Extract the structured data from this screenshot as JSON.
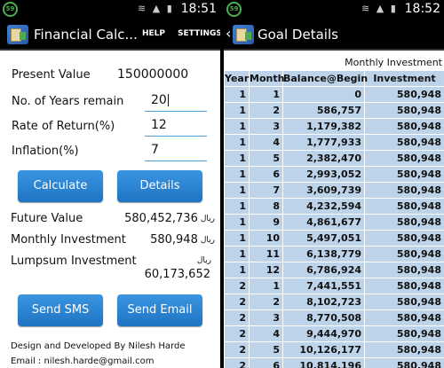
{
  "status": {
    "badge": "59",
    "time_left": "18:51",
    "time_right": "18:52"
  },
  "left_screen": {
    "title": "Financial Calc...",
    "menu": {
      "help": "HELP",
      "settings": "SETTINGS"
    },
    "fields": {
      "present_value": {
        "label": "Present Value",
        "value": "150000000"
      },
      "years": {
        "label": "No. of Years remain",
        "value": "20"
      },
      "return_rate": {
        "label": "Rate of Return(%)",
        "value": "12"
      },
      "inflation": {
        "label": "Inflation(%)",
        "value": "7"
      }
    },
    "buttons": {
      "calculate": "Calculate",
      "details": "Details",
      "send_sms": "Send SMS",
      "send_email": "Send Email"
    },
    "currency": "ریال",
    "results": {
      "future_value": {
        "label": "Future Value",
        "value": "580,452,736"
      },
      "monthly_investment": {
        "label": "Monthly Investment",
        "value": "580,948"
      },
      "lumpsum_investment": {
        "label": "Lumpsum Investment",
        "value": "60,173,652"
      }
    },
    "footer": {
      "line1": "Design and Developed By Nilesh Harde",
      "line2": "Email : nilesh.harde@gmail.com"
    }
  },
  "right_screen": {
    "title": "Goal Details",
    "subtitle": "Monthly Investment",
    "table": {
      "headers": [
        "Year",
        "Month",
        "Balance@Begin",
        "Investment"
      ],
      "rows": [
        [
          "1",
          "1",
          "0",
          "580,948"
        ],
        [
          "1",
          "2",
          "586,757",
          "580,948"
        ],
        [
          "1",
          "3",
          "1,179,382",
          "580,948"
        ],
        [
          "1",
          "4",
          "1,777,933",
          "580,948"
        ],
        [
          "1",
          "5",
          "2,382,470",
          "580,948"
        ],
        [
          "1",
          "6",
          "2,993,052",
          "580,948"
        ],
        [
          "1",
          "7",
          "3,609,739",
          "580,948"
        ],
        [
          "1",
          "8",
          "4,232,594",
          "580,948"
        ],
        [
          "1",
          "9",
          "4,861,677",
          "580,948"
        ],
        [
          "1",
          "10",
          "5,497,051",
          "580,948"
        ],
        [
          "1",
          "11",
          "6,138,779",
          "580,948"
        ],
        [
          "1",
          "12",
          "6,786,924",
          "580,948"
        ],
        [
          "2",
          "1",
          "7,441,551",
          "580,948"
        ],
        [
          "2",
          "2",
          "8,102,723",
          "580,948"
        ],
        [
          "2",
          "3",
          "8,770,508",
          "580,948"
        ],
        [
          "2",
          "4",
          "9,444,970",
          "580,948"
        ],
        [
          "2",
          "5",
          "10,126,177",
          "580,948"
        ],
        [
          "2",
          "6",
          "10,814,196",
          "580,948"
        ]
      ]
    }
  }
}
